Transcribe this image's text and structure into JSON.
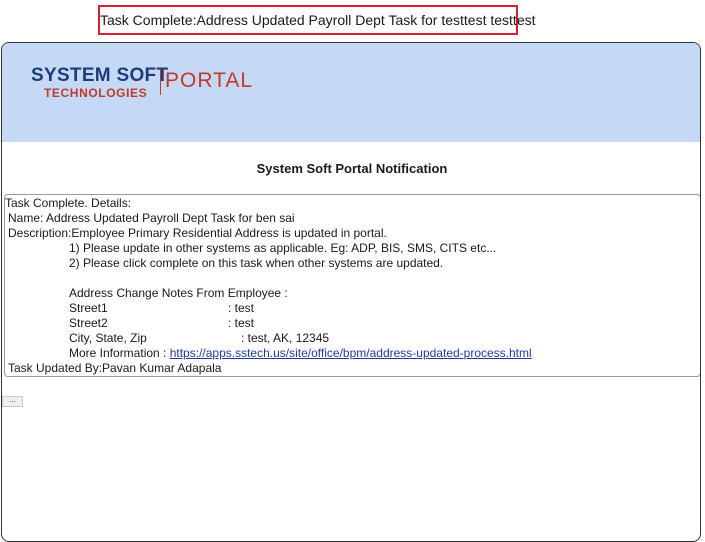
{
  "email_subject": "Task Complete:Address Updated Payroll Dept Task for testtest testtest",
  "logo": {
    "main": "SYSTEM SOFT",
    "sub": "TECHNOLOGIES",
    "portal": "PORTAL"
  },
  "notification_title": "System Soft Portal Notification",
  "details": {
    "status_line": "Task Complete.  Details:",
    "name_line": "Name: Address Updated Payroll Dept Task for ben sai",
    "description_line": "Description:Employee Primary Residential Address is updated in portal.",
    "step1": "1) Please update in other systems as applicable. Eg: ADP, BIS, SMS, CITS etc...",
    "step2": "2) Please click complete on this task when other systems are updated.",
    "notes_header": "Address Change Notes From Employee  :",
    "fields": [
      {
        "label": "Street1",
        "value": ": test"
      },
      {
        "label": "Street2",
        "value": ": test"
      },
      {
        "label": "City, State, Zip",
        "value": ": test, AK, 12345"
      }
    ],
    "more_info_label": "More Information : ",
    "more_info_url": "https://apps.sstech.us/site/office/bpm/address-updated-process.html",
    "updated_by": "Task Updated By:Pavan Kumar Adapala"
  },
  "more_button_label": "..."
}
